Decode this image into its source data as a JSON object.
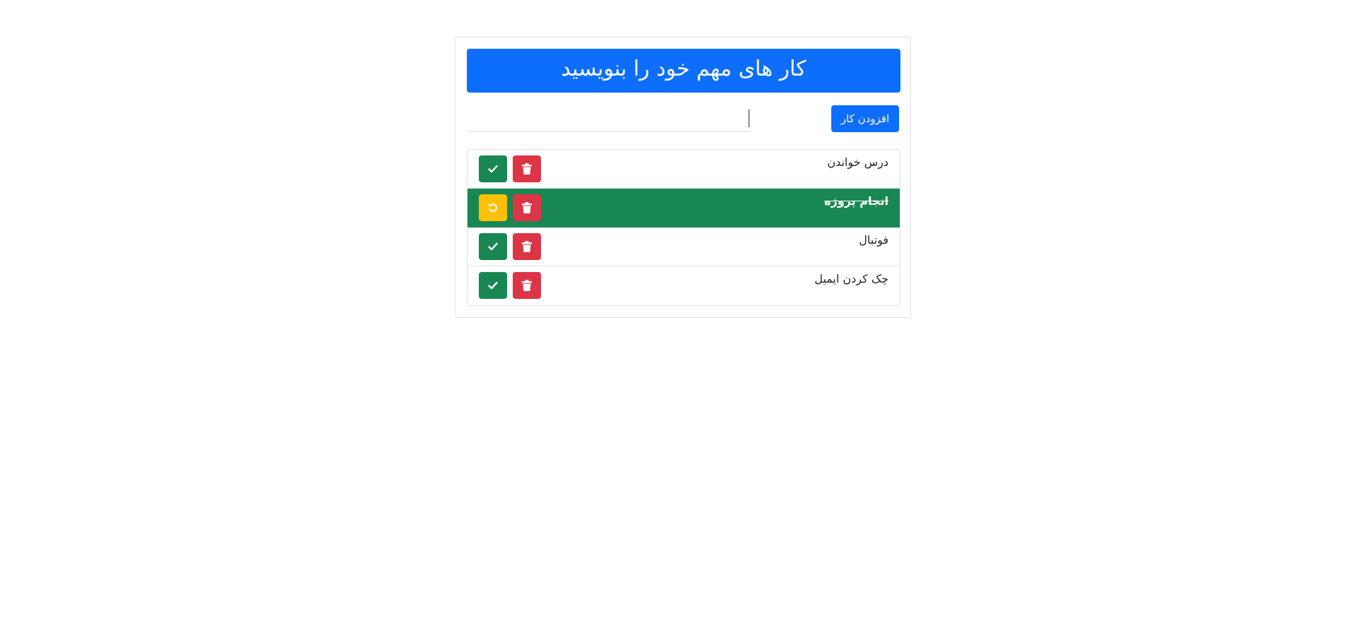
{
  "header": {
    "title": "کار های مهم خود را بنویسید"
  },
  "form": {
    "add_button_label": "افزودن کار",
    "input_value": ""
  },
  "tasks": [
    {
      "label": "درس خواندن",
      "done": false
    },
    {
      "label": "انجام پروژه",
      "done": true
    },
    {
      "label": "فوتبال",
      "done": false
    },
    {
      "label": "چک کردن ایمیل",
      "done": false
    }
  ],
  "icons": {
    "complete": "check-icon",
    "delete": "trash-icon",
    "undo": "undo-icon"
  },
  "colors": {
    "primary": "#0d6efd",
    "success": "#198754",
    "danger": "#dc3545",
    "warning": "#ffc107"
  }
}
